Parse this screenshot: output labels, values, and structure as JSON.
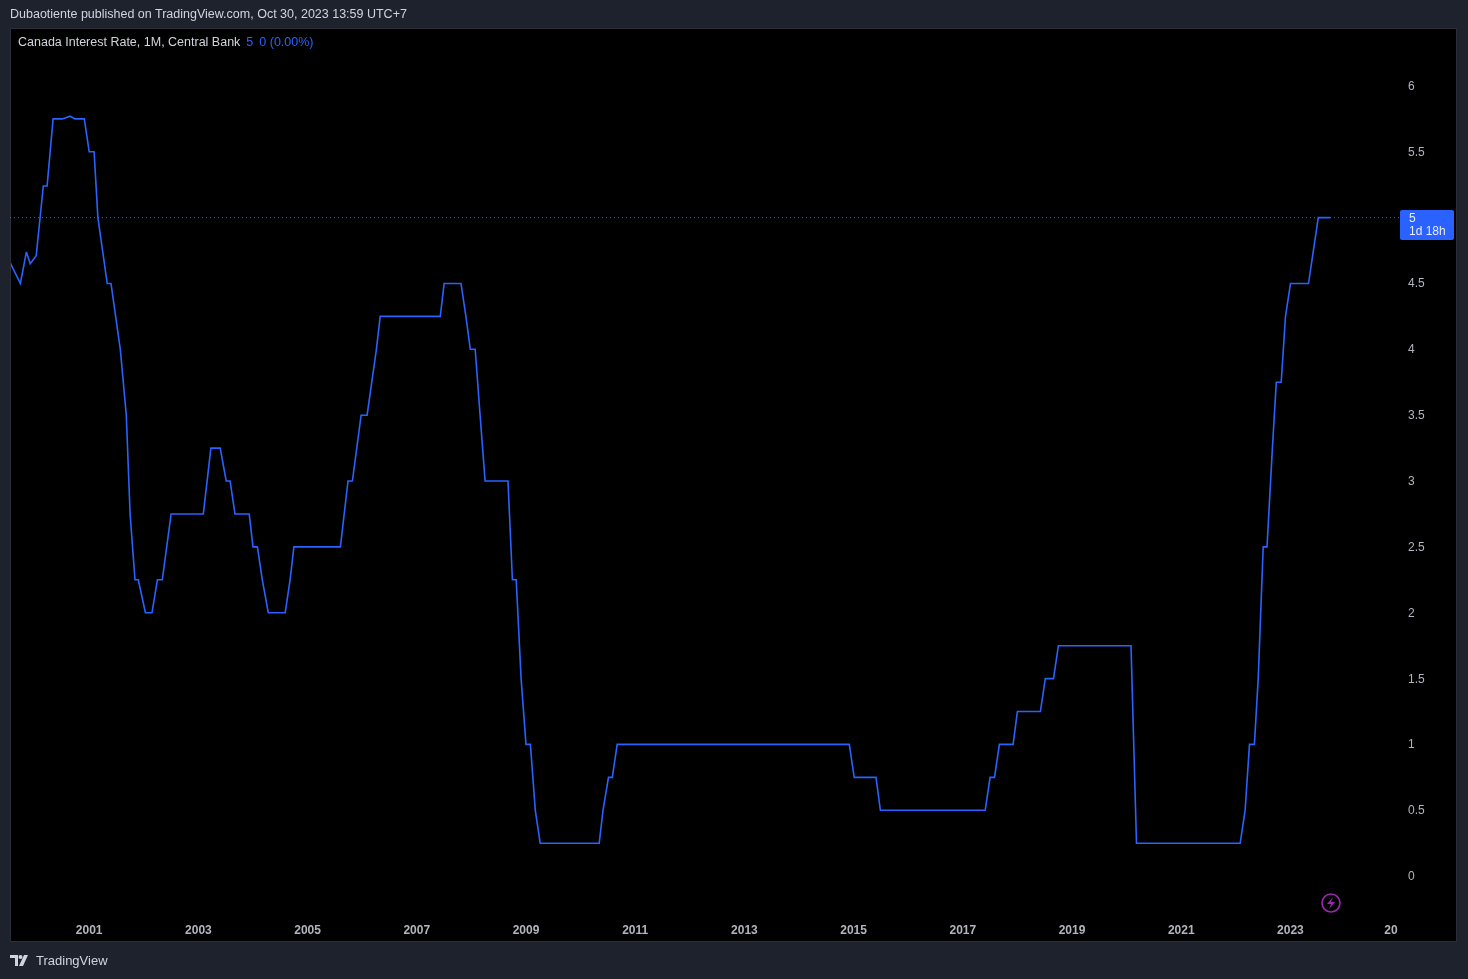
{
  "header": {
    "publisher_line": "Dubaotiente published on TradingView.com, Oct 30, 2023 13:59 UTC+7"
  },
  "chart": {
    "legend": {
      "title": "Canada Interest Rate, 1M, Central Bank",
      "last_value": "5",
      "change": "0 (0.00%)"
    },
    "price_label": {
      "value": "5",
      "countdown": "1d 18h"
    },
    "cut_axis_label": "20",
    "chart_data": {
      "type": "line",
      "x": [
        1999.55,
        1999.74,
        1999.85,
        1999.92,
        2000.03,
        2000.16,
        2000.23,
        2000.34,
        2000.51,
        2000.65,
        2000.74,
        2000.91,
        2001.0,
        2001.09,
        2001.16,
        2001.33,
        2001.4,
        2001.57,
        2001.68,
        2001.75,
        2001.84,
        2001.9,
        2002.03,
        2002.15,
        2002.25,
        2002.34,
        2002.5,
        2003.09,
        2003.23,
        2003.4,
        2003.51,
        2003.58,
        2003.67,
        2003.93,
        2004.0,
        2004.08,
        2004.17,
        2004.28,
        2004.59,
        2004.68,
        2004.75,
        2005.6,
        2005.74,
        2005.82,
        2005.98,
        2006.09,
        2006.26,
        2006.33,
        2007.43,
        2007.5,
        2007.81,
        2007.9,
        2007.98,
        2008.07,
        2008.16,
        2008.25,
        2008.67,
        2008.75,
        2008.82,
        2008.91,
        2009.0,
        2009.08,
        2009.17,
        2009.26,
        2010.34,
        2010.41,
        2010.51,
        2010.58,
        2010.67,
        2014.92,
        2015.01,
        2015.41,
        2015.49,
        2017.41,
        2017.5,
        2017.58,
        2017.67,
        2017.92,
        2018.0,
        2018.42,
        2018.51,
        2018.66,
        2018.75,
        2020.08,
        2020.18,
        2022.08,
        2022.17,
        2022.25,
        2022.34,
        2022.41,
        2022.5,
        2022.57,
        2022.67,
        2022.74,
        2022.83,
        2022.91,
        2023.0,
        2023.33,
        2023.51,
        2023.73
      ],
      "series": [
        {
          "color": "#2962ff",
          "values": [
            4.66,
            4.5,
            4.74,
            4.65,
            4.71,
            5.24,
            5.24,
            5.75,
            5.75,
            5.77,
            5.75,
            5.75,
            5.5,
            5.5,
            5.0,
            4.5,
            4.5,
            4.0,
            3.5,
            2.75,
            2.25,
            2.25,
            2.0,
            2.0,
            2.25,
            2.25,
            2.75,
            2.75,
            3.25,
            3.25,
            3.0,
            3.0,
            2.75,
            2.75,
            2.5,
            2.5,
            2.25,
            2.0,
            2.0,
            2.25,
            2.5,
            2.5,
            3.0,
            3.0,
            3.5,
            3.5,
            4.0,
            4.25,
            4.25,
            4.5,
            4.5,
            4.25,
            4.0,
            4.0,
            3.5,
            3.0,
            3.0,
            2.25,
            2.25,
            1.5,
            1.0,
            1.0,
            0.5,
            0.25,
            0.25,
            0.5,
            0.75,
            0.75,
            1.0,
            1.0,
            0.75,
            0.75,
            0.5,
            0.5,
            0.75,
            0.75,
            1.0,
            1.0,
            1.25,
            1.25,
            1.5,
            1.5,
            1.75,
            1.75,
            0.25,
            0.25,
            0.5,
            1.0,
            1.0,
            1.5,
            2.5,
            2.5,
            3.25,
            3.75,
            3.75,
            4.25,
            4.5,
            4.5,
            5.0,
            5.0
          ]
        }
      ],
      "ref_lines": [
        {
          "axis": "y",
          "value": 5,
          "color": "#2962ff"
        }
      ],
      "xlim": [
        1999.55,
        2026.05
      ],
      "ylim": [
        -0.5,
        6.44
      ],
      "xticks": [
        2001,
        2003,
        2005,
        2007,
        2009,
        2011,
        2013,
        2015,
        2017,
        2019,
        2021,
        2023
      ],
      "yticks": [
        0,
        0.5,
        1,
        1.5,
        2,
        2.5,
        3,
        3.5,
        4,
        4.5,
        5.5,
        6
      ]
    }
  },
  "footer": {
    "brand": "TradingView"
  }
}
